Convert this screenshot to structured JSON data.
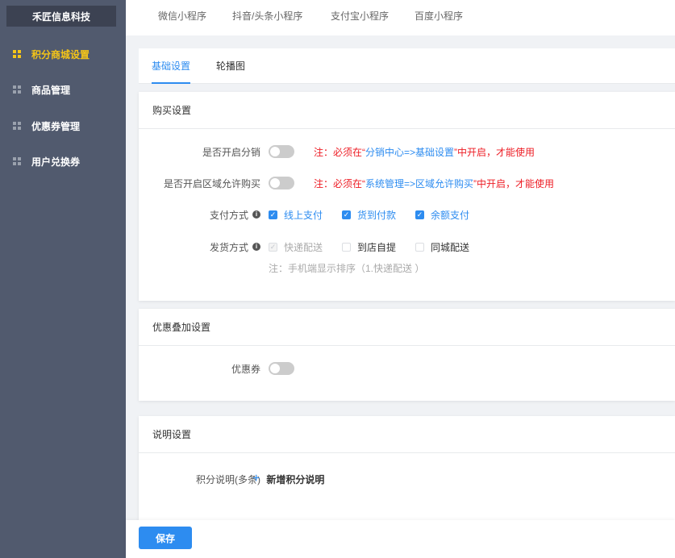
{
  "sidebar": {
    "brand": "禾匠信息科技",
    "items": [
      {
        "label": "积分商城设置",
        "active": true
      },
      {
        "label": "商品管理",
        "active": false
      },
      {
        "label": "优惠券管理",
        "active": false
      },
      {
        "label": "用户兑换券",
        "active": false
      }
    ]
  },
  "topbar": {
    "tabs": [
      "微信小程序",
      "抖音/头条小程序",
      "支付宝小程序",
      "百度小程序"
    ]
  },
  "subtabs": {
    "items": [
      {
        "label": "基础设置",
        "active": true
      },
      {
        "label": "轮播图",
        "active": false
      }
    ]
  },
  "purchase": {
    "title": "购买设置",
    "distribution": {
      "label": "是否开启分销",
      "enabled": false,
      "note_prefix": "注：必须在“",
      "note_link": "分销中心=>基础设置",
      "note_suffix": "”中开启，才能使用"
    },
    "region": {
      "label": "是否开启区域允许购买",
      "enabled": false,
      "note_prefix": "注：必须在“",
      "note_link": "系统管理=>区域允许购买",
      "note_suffix": "”中开启，才能使用"
    },
    "payment": {
      "label": "支付方式",
      "options": [
        {
          "label": "线上支付",
          "checked": true
        },
        {
          "label": "货到付款",
          "checked": true
        },
        {
          "label": "余额支付",
          "checked": true
        }
      ]
    },
    "delivery": {
      "label": "发货方式",
      "options": [
        {
          "label": "快递配送",
          "checked": true,
          "disabled": true
        },
        {
          "label": "到店自提",
          "checked": false
        },
        {
          "label": "同城配送",
          "checked": false
        }
      ],
      "hint": "注：手机端显示排序（1.快递配送 ）"
    }
  },
  "discount": {
    "title": "优惠叠加设置",
    "coupon": {
      "label": "优惠券",
      "enabled": false
    }
  },
  "explain": {
    "title": "说明设置",
    "label": "积分说明(多条)",
    "add_label": "新增积分说明"
  },
  "footer": {
    "save_label": "保存"
  },
  "icons": {
    "nav": "grid-icon",
    "info": "info-icon",
    "plus": "plus-icon",
    "check": "check-icon"
  },
  "colors": {
    "sidebar_bg": "#515a6e",
    "active_nav": "#f5c518",
    "primary": "#2d8cf0",
    "danger": "#ed1c24"
  }
}
